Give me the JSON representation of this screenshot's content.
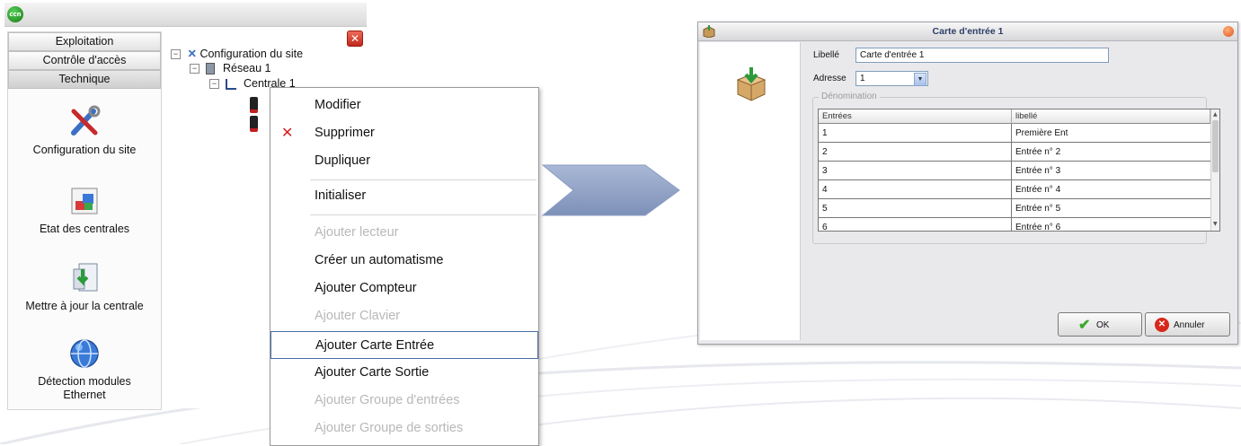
{
  "left_app": {
    "logo_text": "ccn",
    "nav_tabs": [
      "Exploitation",
      "Contrôle d'accès",
      "Technique"
    ],
    "nav_items": [
      {
        "label": "Configuration du site",
        "icon": "tools-icon"
      },
      {
        "label": "Etat des centrales",
        "icon": "cubes-icon"
      },
      {
        "label": "Mettre à jour la centrale",
        "icon": "update-icon"
      },
      {
        "label": "Détection modules Ethernet",
        "icon": "globe-icon"
      }
    ],
    "tree": {
      "root": "Configuration du site",
      "network": "Réseau 1",
      "central": "Centrale 1"
    },
    "close_glyph": "✕"
  },
  "context_menu": {
    "items": [
      {
        "label": "Modifier",
        "enabled": true
      },
      {
        "label": "Supprimer",
        "enabled": true,
        "icon": "delete-x-icon"
      },
      {
        "label": "Dupliquer",
        "enabled": true
      },
      {
        "label": "Initialiser",
        "enabled": true
      },
      {
        "label": "Ajouter lecteur",
        "enabled": false
      },
      {
        "label": "Créer un automatisme",
        "enabled": true
      },
      {
        "label": "Ajouter Compteur",
        "enabled": true
      },
      {
        "label": "Ajouter Clavier",
        "enabled": false
      },
      {
        "label": "Ajouter Carte Entrée",
        "enabled": true,
        "highlighted": true
      },
      {
        "label": "Ajouter Carte Sortie",
        "enabled": true
      },
      {
        "label": "Ajouter Groupe d'entrées",
        "enabled": false
      },
      {
        "label": "Ajouter Groupe de sorties",
        "enabled": false
      }
    ]
  },
  "dialog": {
    "title": "Carte d'entrée 1",
    "libelle_label": "Libellé",
    "libelle_value": "Carte d'entrée 1",
    "adresse_label": "Adresse",
    "adresse_value": "1",
    "group_label": "Dénomination",
    "grid_headers": [
      "Entrées",
      "libellé"
    ],
    "grid_rows": [
      [
        "1",
        "Première Ent"
      ],
      [
        "2",
        "Entrée n° 2"
      ],
      [
        "3",
        "Entrée n° 3"
      ],
      [
        "4",
        "Entrée n° 4"
      ],
      [
        "5",
        "Entrée n° 5"
      ],
      [
        "6",
        "Entrée n° 6"
      ]
    ],
    "ok_label": "OK",
    "cancel_label": "Annuler"
  },
  "colors": {
    "arrow": "#8c9fc4",
    "menu_highlight_border": "#4a6ea6",
    "dialog_title_text": "#2c3e66"
  }
}
